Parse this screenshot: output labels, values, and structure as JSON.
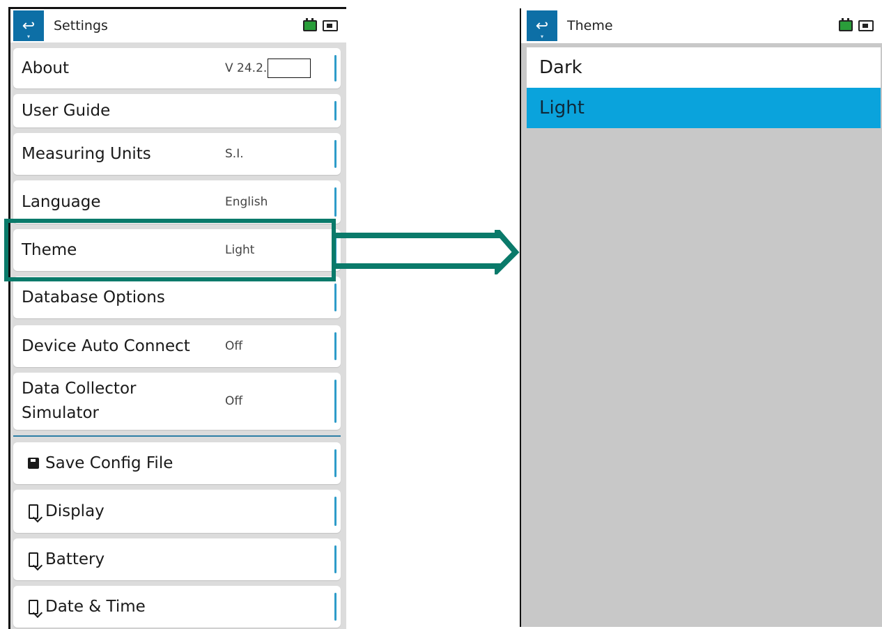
{
  "left_screen": {
    "title": "Settings",
    "items": [
      {
        "label": "About",
        "value": "V 24.2."
      },
      {
        "label": "User Guide",
        "value": ""
      },
      {
        "label": "Measuring Units",
        "value": "S.I."
      },
      {
        "label": "Language",
        "value": "English"
      },
      {
        "label": "Theme",
        "value": "Light"
      },
      {
        "label": "Database Options",
        "value": ""
      },
      {
        "label": "Device Auto Connect",
        "value": "Off"
      },
      {
        "label_line1": "Data Collector",
        "label_line2": "Simulator",
        "value": "Off"
      }
    ],
    "actions": [
      {
        "label": "Save Config File",
        "icon": "floppy-disk-icon"
      },
      {
        "label": "Display",
        "icon": "device-settings-icon"
      },
      {
        "label": "Battery",
        "icon": "device-settings-icon"
      },
      {
        "label": "Date & Time",
        "icon": "device-settings-icon"
      }
    ]
  },
  "right_screen": {
    "title": "Theme",
    "options": [
      {
        "label": "Dark",
        "selected": false
      },
      {
        "label": "Light",
        "selected": true
      }
    ]
  },
  "colors": {
    "accent_blue": "#0d6fa6",
    "selected_blue": "#0aa3dc",
    "highlight_green": "#0a7a6a"
  }
}
